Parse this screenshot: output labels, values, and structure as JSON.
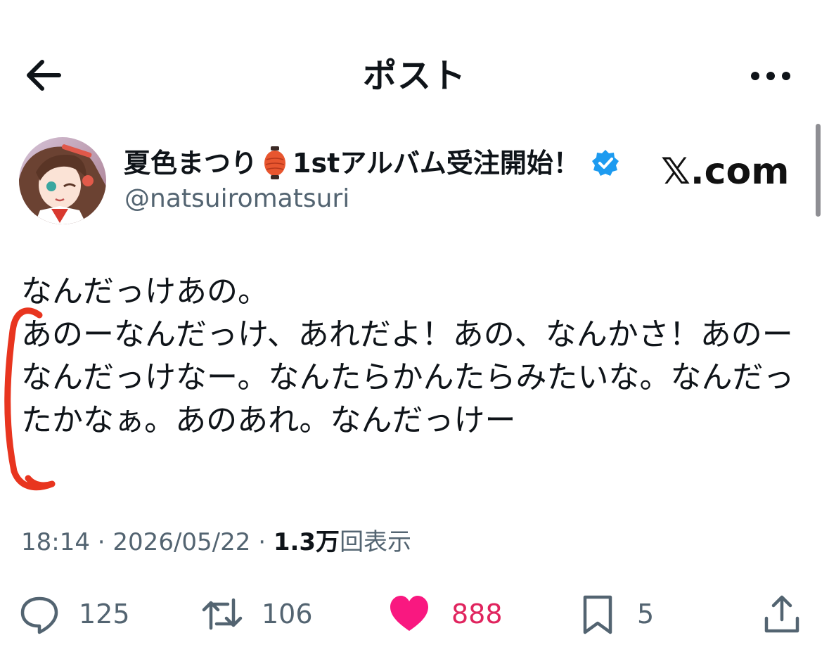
{
  "header": {
    "title": "ポスト"
  },
  "author": {
    "name_part1": "夏色まつり",
    "name_part2": "1stアルバム受注開始！",
    "handle": "@natsuiromatsuri",
    "verified": true
  },
  "watermark": {
    "text": "𝕏.com"
  },
  "post": {
    "text": "なんだっけあの。\nあのーなんだっけ、あれだよ！あの、なんかさ！あのー\nなんだっけなー。なんたらかんたらみたいな。なんだっ\nたかなぁ。あのあれ。なんだっけー"
  },
  "meta": {
    "time": "18:14",
    "separator": " · ",
    "date": "2026/05/22",
    "views_count": "1.3万",
    "views_label": "回表示"
  },
  "actions": {
    "reply_count": "125",
    "repost_count": "106",
    "like_count": "888",
    "bookmark_count": "5"
  },
  "colors": {
    "text": "#0f1419",
    "secondary": "#536471",
    "like": "#e0245e",
    "verified": "#1d9bf0",
    "annotation": "#e8351f"
  }
}
